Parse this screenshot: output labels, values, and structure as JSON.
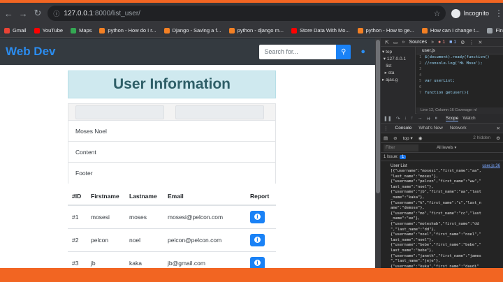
{
  "browser": {
    "url_host": "127.0.0.1",
    "url_path": ":8000/list_user/",
    "profile": "Incognito",
    "bookmarks": [
      {
        "label": "Gmail",
        "color": "#ea4335"
      },
      {
        "label": "YouTube",
        "color": "#ff0000"
      },
      {
        "label": "Maps",
        "color": "#34a853"
      },
      {
        "label": "python - How do I r...",
        "color": "#f48024"
      },
      {
        "label": "Django - Saving a f...",
        "color": "#f48024"
      },
      {
        "label": "python - django m...",
        "color": "#f48024"
      },
      {
        "label": "Store Data With Mo...",
        "color": "#ff0000"
      },
      {
        "label": "python - How to ge...",
        "color": "#f48024"
      },
      {
        "label": "How can I change t...",
        "color": "#f48024"
      },
      {
        "label": "Find Broken Links,...",
        "color": "#3c3c3c"
      }
    ]
  },
  "site": {
    "brand": "Web Dev",
    "search_placeholder": "Search for...",
    "heading": "User Information",
    "card": {
      "row1": "Moses Noel",
      "row2": "Content",
      "row3": "Footer"
    },
    "table": {
      "headers": [
        "#ID",
        "Firstname",
        "Lastname",
        "Email",
        "Report"
      ],
      "rows": [
        {
          "id": "#1",
          "first": "mosesi",
          "last": "moses",
          "email": "mosesi@pelcon.com"
        },
        {
          "id": "#2",
          "first": "pelcon",
          "last": "noel",
          "email": "pelcon@pelcon.com"
        },
        {
          "id": "#3",
          "first": "jb",
          "last": "kaka",
          "email": "jb@gmail.com"
        }
      ]
    }
  },
  "devtools": {
    "tab_sources": "Sources",
    "errors": "1",
    "warnings": "1",
    "tree": [
      "top",
      "127.0.0.1",
      "list",
      "sta",
      "ajax.g"
    ],
    "file_tab": "user.js",
    "code": [
      {
        "n": "1",
        "t": "$(document).ready(function()"
      },
      {
        "n": "2",
        "t": "//console.log('Hi Mose');"
      },
      {
        "n": "3",
        "t": ""
      },
      {
        "n": "4",
        "t": ""
      },
      {
        "n": "5",
        "t": "var userList;"
      },
      {
        "n": "6",
        "t": ""
      },
      {
        "n": "7",
        "t": "function getuser(){"
      }
    ],
    "status": "Line 12, Column 16   Coverage: n/",
    "scope": "Scope",
    "watch": "Watch",
    "drawer_tabs": [
      "Console",
      "What's New",
      "Network"
    ],
    "context": "top",
    "hidden": "2 hidden",
    "filter_placeholder": "Filter",
    "levels": "All levels",
    "issues_label": "1 Issue:",
    "issues_count": "1",
    "log_title": "User List",
    "log_src": "user.js:36",
    "log_lines": "[{\"username\":\"mosesi\",\"first_name\":\"aa\",\n\"last_name\":\"moses\"},\n{\"username\":\"pelcon\",\"first_name\":\"ww\",\"\nlast_name\":\"noel\"},\n{\"username\":\"jb\",\"first_name\":\"aa\",\"last\n_name\":\"kaka\"},\n{\"username\":\"k\",\"first_name\":\"c\",\"last_n\name\":\"demose\"},\n{\"username\":\"mo\",\"first_name\":\"cc\",\"last\n_name\":\"ee\"},\n{\"username\":\"moteshab\",\"first_name\":\"dd\n\",\"last_name\":\"dd\"},\n{\"username\":\"noel\",\"first_name\":\"noel\",\"\nlast_name\":\"noel\"},\n{\"username\":\"bebe\",\"first_name\":\"bebe\",\"\nlast_name\":\"bebe\"},\n{\"username\":\"janeth\",\"first_name\":\"james\n\",\"last_name\":\"jeje\"},\n{\"username\":\"kuku\",\"first_name\":\"daudi\""
  }
}
